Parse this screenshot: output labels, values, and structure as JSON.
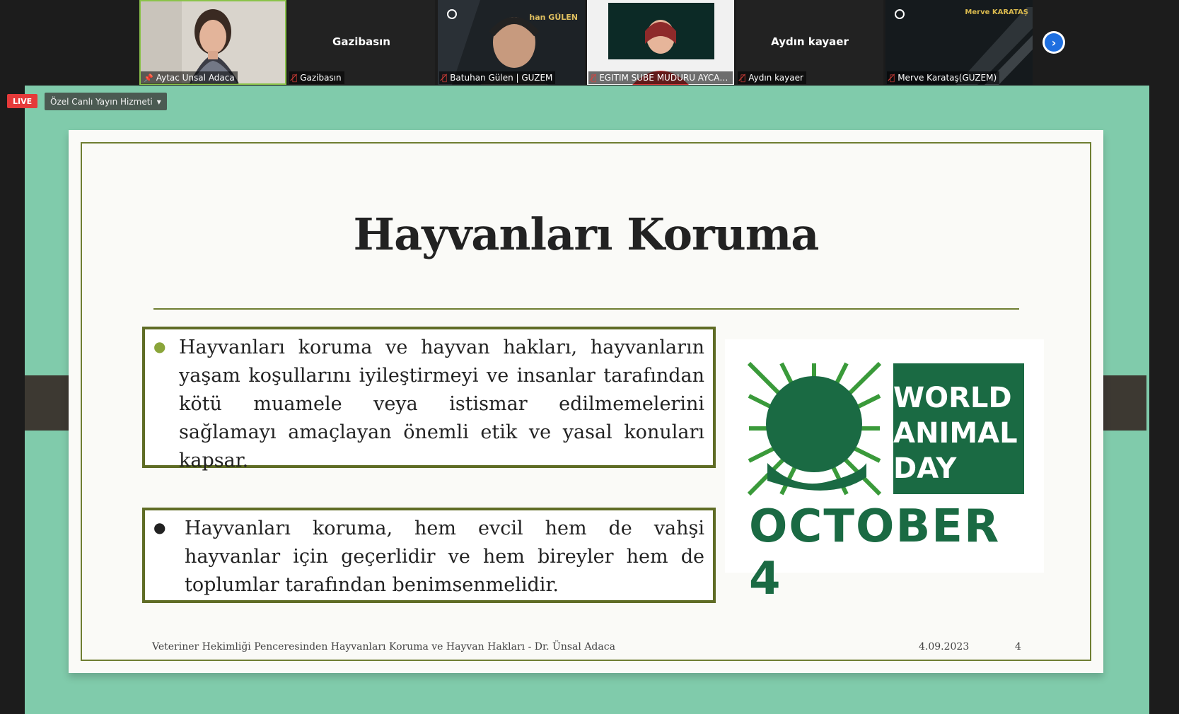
{
  "participants": [
    {
      "name": "Aytac Unsal Adaca",
      "status_icon": "pin-icon",
      "video": "webcam"
    },
    {
      "name": "Gazibasın",
      "center_name": "Gazibasın",
      "status_icon": "mic-off-icon",
      "video": "none"
    },
    {
      "name": "Batuhan Gülen | GUZEM",
      "overlay_text": "han GÜLEN",
      "status_icon": "mic-off-icon",
      "video": "webcam"
    },
    {
      "name": "EGITIM SUBE MUDURU AYCA ...",
      "status_icon": "mic-off-icon",
      "video": "webcam"
    },
    {
      "name": "Aydın kayaer",
      "center_name": "Aydın kayaer",
      "status_icon": "mic-off-icon",
      "video": "none"
    },
    {
      "name": "Merve Karataş(GUZEM)",
      "overlay_text": "Merve KARATAŞ",
      "status_icon": "mic-off-icon",
      "video": "webcam"
    }
  ],
  "controls": {
    "next_icon": "chevron-right-icon",
    "live_badge": "LIVE",
    "stream_label": "Özel Canlı Yayın Hizmeti",
    "stream_caret": "▾"
  },
  "slide": {
    "title": "Hayvanları Koruma",
    "bullets": [
      "Hayvanları koruma ve hayvan hakları, hayvanların yaşam koşullarını iyileştirmeyi ve insanlar tarafından kötü muamele veya istismar edilmemelerini sağlamayı amaçlayan önemli etik ve yasal konuları kapsar.",
      "Hayvanları koruma, hem evcil hem de vahşi hayvanlar için geçerlidir ve hem bireyler hem de toplumlar tarafından benimsenmelidir."
    ],
    "image": {
      "line1": "WORLD",
      "line2": "ANIMAL",
      "line3": "DAY",
      "date": "OCTOBER 4"
    },
    "footer": "Veteriner Hekimliği Penceresinden Hayvanları Koruma ve Hayvan Hakları - Dr. Ünsal Adaca",
    "date": "4.09.2023",
    "page": "4"
  },
  "colors": {
    "stage_bg": "#80cbab",
    "frame_green": "#6f7e32",
    "wad_green": "#1a6a43",
    "live_red": "#e53a3a"
  }
}
